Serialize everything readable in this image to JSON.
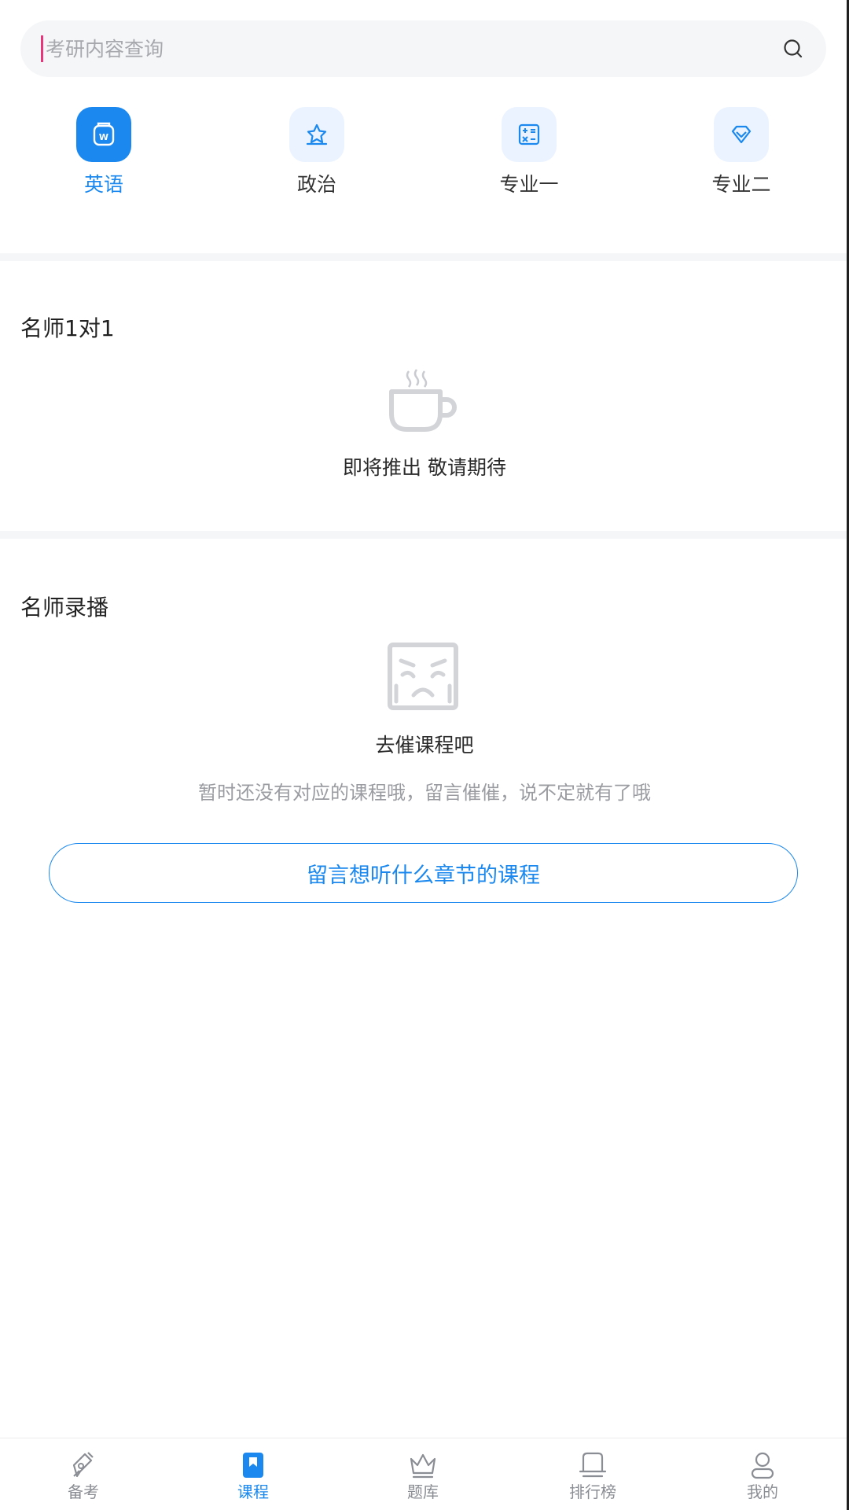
{
  "search": {
    "placeholder": "考研内容查询"
  },
  "subjects": [
    {
      "label": "英语",
      "icon": "english-book-icon",
      "active": true
    },
    {
      "label": "政治",
      "icon": "politics-star-icon",
      "active": false
    },
    {
      "label": "专业一",
      "icon": "calculator-icon",
      "active": false
    },
    {
      "label": "专业二",
      "icon": "diamond-icon",
      "active": false
    }
  ],
  "sections": {
    "one_on_one": {
      "title": "名师1对1",
      "icon": "coffee-cup-icon",
      "empty_title": "即将推出 敬请期待"
    },
    "recorded": {
      "title": "名师录播",
      "icon": "sad-face-box-icon",
      "empty_title": "去催课程吧",
      "empty_desc": "暂时还没有对应的课程哦，留言催催，说不定就有了哦",
      "button_label": "留言想听什么章节的课程"
    }
  },
  "nav": [
    {
      "label": "备考",
      "icon": "pen-nib-icon",
      "active": false
    },
    {
      "label": "课程",
      "icon": "bookmark-book-icon",
      "active": true
    },
    {
      "label": "题库",
      "icon": "crown-icon",
      "active": false
    },
    {
      "label": "排行榜",
      "icon": "podium-icon",
      "active": false
    },
    {
      "label": "我的",
      "icon": "user-icon",
      "active": false
    }
  ],
  "colors": {
    "accent": "#1a88ee",
    "caret": "#e8367a",
    "muted": "#9a9ca1"
  }
}
